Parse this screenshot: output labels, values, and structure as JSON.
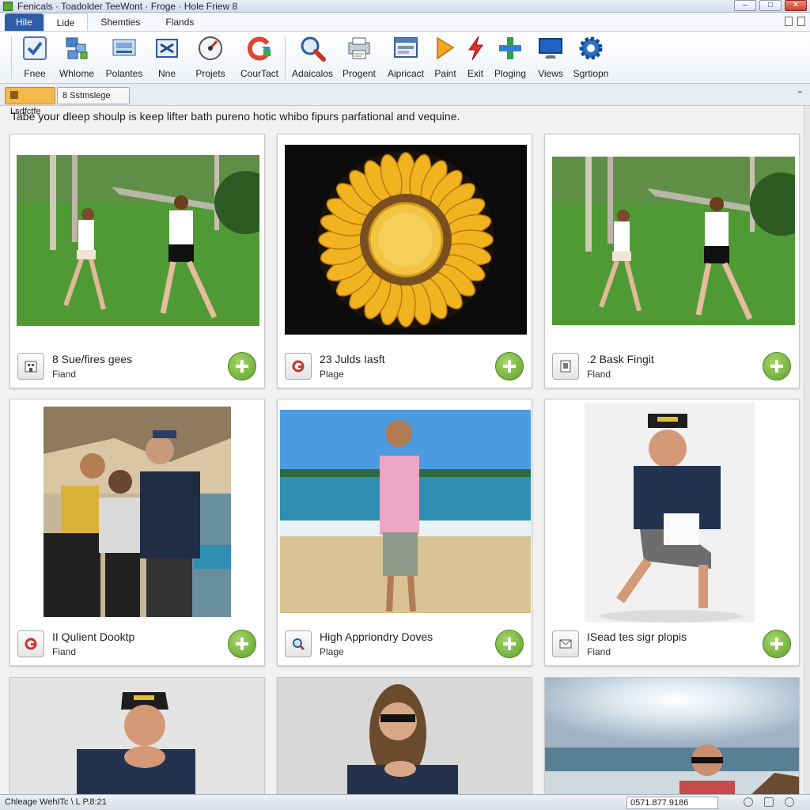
{
  "window": {
    "title": "Fenicals · Toadolder TeeWont · Froge · Hole Friew 8",
    "buttons": [
      "–",
      "□",
      "✕"
    ]
  },
  "menu": {
    "file": "Hile",
    "tabs": [
      "Lide",
      "Shemties",
      "Flands"
    ]
  },
  "ribbon": {
    "items": [
      {
        "label": "Fnee",
        "icon": "checkmark-icon"
      },
      {
        "label": "Whlome",
        "icon": "network-icon"
      },
      {
        "label": "Polantes",
        "icon": "scanner-icon"
      },
      {
        "label": "Nne",
        "icon": "switch-icon"
      },
      {
        "label": "Projets",
        "icon": "gauge-icon"
      },
      {
        "label": "CourTact",
        "icon": "refresh-icon"
      },
      {
        "label": "Adaicalos",
        "icon": "magnifier-icon"
      },
      {
        "label": "Progent",
        "icon": "printer-icon"
      },
      {
        "label": "Aipricact",
        "icon": "window-icon"
      },
      {
        "label": "Paint",
        "icon": "paint-icon"
      },
      {
        "label": "Exit",
        "icon": "lightning-icon"
      },
      {
        "label": "Ploging",
        "icon": "plus-icon"
      },
      {
        "label": "Views",
        "icon": "monitor-icon"
      },
      {
        "label": "Sgrtiopn",
        "icon": "gear-icon"
      }
    ]
  },
  "doc_tabs": [
    "Lsdfctfe",
    "8 Sstmslege"
  ],
  "caption": "Tabe your dleep shoulp is keep lifter bath pureno hotic whibo fipurs parfational and vequine.",
  "cards": [
    {
      "title": "8 Sue/fires gees",
      "subtitle": "Fiand",
      "icon": "building-icon",
      "photo": "two-women-dancing-in-park"
    },
    {
      "title": "23 Julds Iasft",
      "subtitle": "Plage",
      "icon": "google-icon",
      "photo": "sunflower-on-black"
    },
    {
      "title": ".2 Bask Fingit",
      "subtitle": "Fland",
      "icon": "document-icon",
      "photo": "two-women-dancing-in-park"
    },
    {
      "title": "II Qulient Dooktp",
      "subtitle": "Fiand",
      "icon": "google-icon",
      "photo": "three-friends-at-harbor"
    },
    {
      "title": "High Appriondry Doves",
      "subtitle": "Plage",
      "icon": "search-icon",
      "photo": "man-on-beach"
    },
    {
      "title": "ISead tes sigr plopis",
      "subtitle": "Fiand",
      "icon": "mail-icon",
      "photo": "man-kneeling-white-bg"
    },
    {
      "title": "",
      "subtitle": "",
      "icon": "",
      "photo": "man-in-cap-smiling"
    },
    {
      "title": "",
      "subtitle": "",
      "icon": "",
      "photo": "woman-in-sunglasses"
    },
    {
      "title": "",
      "subtitle": "",
      "icon": "",
      "photo": "man-on-sunny-beach"
    }
  ],
  "status": {
    "left": "Chleage WehITc \\ L P.8:21",
    "right": "0571.877.9186"
  },
  "colors": {
    "file_tab": "#2d5da6",
    "active_doc_tab": "#f4b94a",
    "add_button": "#6fb33a"
  }
}
